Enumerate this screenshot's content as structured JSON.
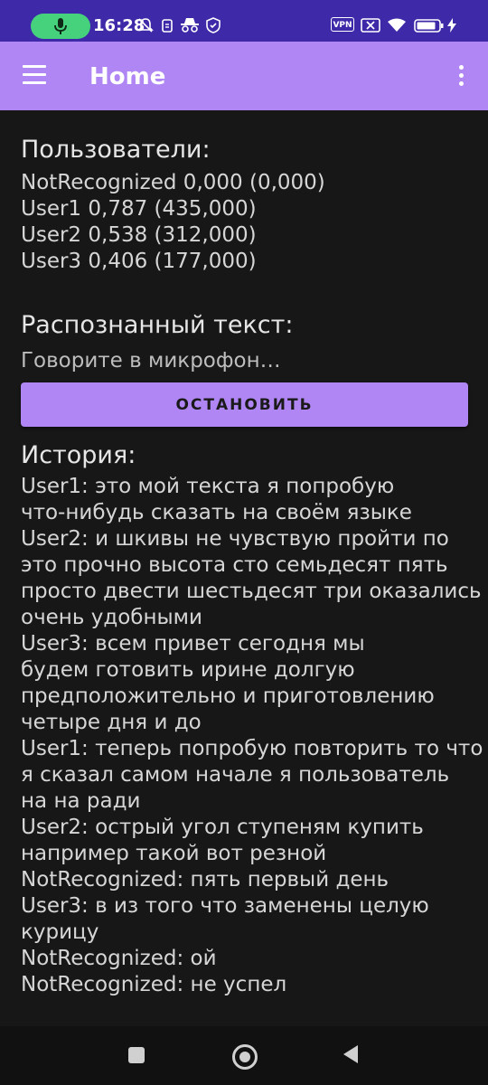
{
  "status_bar": {
    "time": "16:28",
    "vpn_label": "VPN",
    "battery_level": 0.85,
    "icons": [
      "mic-icon",
      "notifications-off-icon",
      "notification-icon",
      "incognito-icon",
      "shield-icon",
      "vpn-icon",
      "no-sim-icon",
      "wifi-icon",
      "battery-icon",
      "charging-icon"
    ]
  },
  "app_bar": {
    "title": "Home",
    "icons": [
      "menu-icon",
      "overflow-menu-icon"
    ]
  },
  "users": {
    "heading": "Пользователи:",
    "lines": [
      "NotRecognized 0,000 (0,000)",
      "User1 0,787 (435,000)",
      "User2 0,538 (312,000)",
      "User3 0,406 (177,000)"
    ]
  },
  "recognized": {
    "heading": "Распознанный текст:",
    "text": "Говорите в микрофон…"
  },
  "stop_button": {
    "label": "ОСТАНОВИТЬ"
  },
  "history": {
    "heading": "История:",
    "lines": [
      "User1: это мой текста я попробую",
      "что-нибудь сказать на своём языке",
      "User2: и шкивы не чувствую пройти по",
      "это прочно высота сто семьдесят пять",
      "просто двести шестьдесят три оказались",
      "очень удобными",
      "User3: всем привет сегодня мы",
      "будем готовить ирине долгую",
      "предположительно и приготовлению",
      "четыре дня и до",
      "User1: теперь попробую повторить то что",
      "я сказал самом начале я пользователь",
      "на на ради",
      "User2: острый угол ступеням купить",
      "например такой вот резной",
      "NotRecognized: пять первый день",
      "User3: в из того что заменены целую",
      "курицу",
      "NotRecognized: ой",
      "NotRecognized: не успел"
    ]
  },
  "nav_bar": {
    "icons": [
      "recents-icon",
      "home-icon",
      "back-icon"
    ]
  }
}
